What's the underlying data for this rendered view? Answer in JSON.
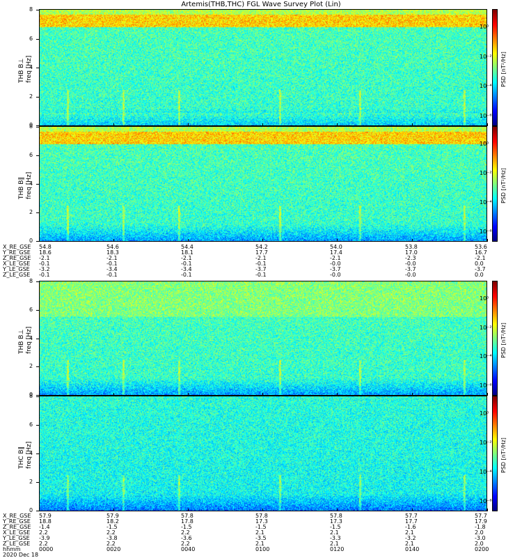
{
  "title": "Artemis(THB,THC) FGL Wave Survey Plot (Lin)",
  "colorbar_label": "PSD [nT²/Hz]",
  "colorbar_ticks": [
    "10⁰",
    "10⁻²",
    "10⁻⁴",
    "10⁻⁶"
  ],
  "panels": [
    {
      "ylabel_probe": "THB B⊥",
      "ylabel_axis": "freq [Hz]"
    },
    {
      "ylabel_probe": "THB B‖",
      "ylabel_axis": "freq [Hz]"
    },
    {
      "ylabel_probe": "THB B⊥",
      "ylabel_axis": "freq [Hz]"
    },
    {
      "ylabel_probe": "THC B‖",
      "ylabel_axis": "freq [Hz]"
    }
  ],
  "ephemeris_top": {
    "rows": [
      {
        "name": "X_RE_GSE",
        "values": [
          "54.8",
          "54.6",
          "54.4",
          "54.2",
          "54.0",
          "53.8",
          "53.6"
        ]
      },
      {
        "name": "Y_RE_GSE",
        "values": [
          "18.6",
          "18.3",
          "18.1",
          "17.7",
          "17.4",
          "17.0",
          "16.7"
        ]
      },
      {
        "name": "Z_RE_GSE",
        "values": [
          "-2.1",
          "-2.1",
          "-2.1",
          "-2.1",
          "-2.1",
          "-2.3",
          "-2.1"
        ]
      },
      {
        "name": "X_LE_GSE",
        "values": [
          "-0.1",
          "-0.1",
          "-0.1",
          "-0.1",
          "-0.0",
          "-0.0",
          "0.0"
        ]
      },
      {
        "name": "Y_LE_GSE",
        "values": [
          "-3.2",
          "-3.4",
          "-3.4",
          "-3.7",
          "-3.7",
          "-3.7",
          "-3.7"
        ]
      },
      {
        "name": "Z_LE_GSE",
        "values": [
          "-0.1",
          "-0.1",
          "-0.1",
          "-0.1",
          "-0.0",
          "-0.0",
          "0.0"
        ]
      }
    ]
  },
  "ephemeris_bottom": {
    "rows": [
      {
        "name": "X_RE_GSE",
        "values": [
          "57.9",
          "57.9",
          "57.8",
          "57.8",
          "57.8",
          "57.7",
          "57.7"
        ]
      },
      {
        "name": "Y_RE_GSE",
        "values": [
          "18.8",
          "18.2",
          "17.8",
          "17.3",
          "17.3",
          "17.7",
          "17.9"
        ]
      },
      {
        "name": "Z_RE_GSE",
        "values": [
          "-1.4",
          "-1.5",
          "-1.5",
          "-1.5",
          "-1.5",
          "-1.6",
          "-1.8"
        ]
      },
      {
        "name": "X_LE_GSE",
        "values": [
          "2.2",
          "2.2",
          "2.2",
          "2.1",
          "2.1",
          "2.1",
          "2.0"
        ]
      },
      {
        "name": "Y_LE_GSE",
        "values": [
          "-3.9",
          "-3.8",
          "-3.6",
          "-3.5",
          "-3.3",
          "-3.2",
          "-3.0"
        ]
      },
      {
        "name": "Z_LE_GSE",
        "values": [
          "2.2",
          "2.2",
          "2.2",
          "2.1",
          "2.1",
          "2.1",
          "2.0"
        ]
      },
      {
        "name": "hhmm",
        "values": [
          "0000",
          "0020",
          "0040",
          "0100",
          "0120",
          "0140",
          "0200"
        ]
      }
    ],
    "date_label": "2020 Dec 18"
  },
  "chart_data": [
    {
      "type": "heatmap",
      "panel": "THB B⊥ (top)",
      "x_label": "hhmm",
      "ylabel": "freq [Hz]",
      "ylim": [
        0,
        8
      ],
      "yticks": [
        0,
        2,
        4,
        6,
        8
      ],
      "color_scale": "log",
      "clim": [
        "1e-6",
        "1e1"
      ],
      "features": {
        "high_power_band_hz": [
          6.8,
          7.6
        ],
        "low_freq_enhancement_hz": [
          0,
          1
        ]
      }
    },
    {
      "type": "heatmap",
      "panel": "THB B‖",
      "x_label": "hhmm",
      "ylabel": "freq [Hz]",
      "ylim": [
        0,
        8
      ],
      "yticks": [
        0,
        2,
        4,
        6,
        8
      ],
      "color_scale": "log",
      "clim": [
        "1e-6",
        "1e1"
      ],
      "features": {
        "high_power_band_hz": [
          6.8,
          7.6
        ]
      }
    },
    {
      "type": "heatmap",
      "panel": "THB B⊥ (bottom)",
      "x_label": "hhmm",
      "ylabel": "freq [Hz]",
      "ylim": [
        0,
        8
      ],
      "yticks": [
        0,
        2,
        4,
        6,
        8
      ],
      "color_scale": "log",
      "clim": [
        "1e-6",
        "1e1"
      ]
    },
    {
      "type": "heatmap",
      "panel": "THC B‖",
      "x_label": "hhmm",
      "ylabel": "freq [Hz]",
      "ylim": [
        0,
        8
      ],
      "yticks": [
        0,
        2,
        4,
        6,
        8
      ],
      "color_scale": "log",
      "clim": [
        "1e-6",
        "1e1"
      ]
    }
  ],
  "colors": {
    "colormap": "jet"
  }
}
